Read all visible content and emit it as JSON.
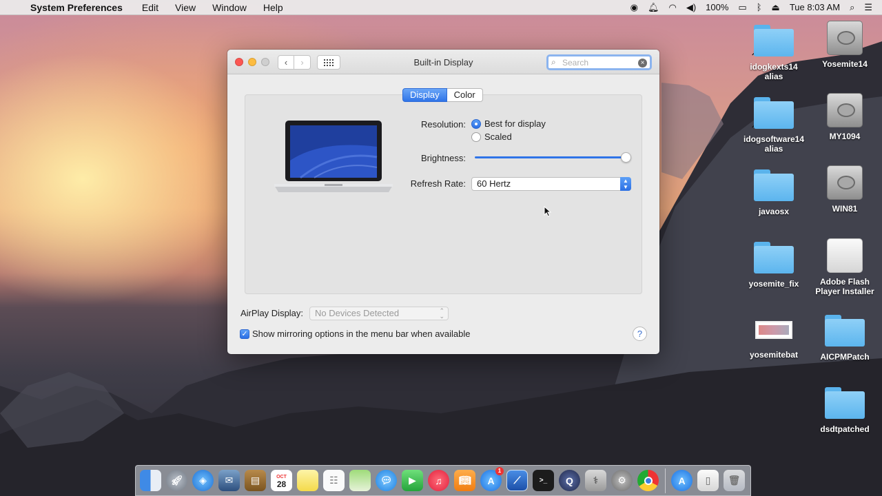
{
  "menubar": {
    "app_name": "System Preferences",
    "menus": [
      "Edit",
      "View",
      "Window",
      "Help"
    ],
    "battery": "100%",
    "clock": "Tue 8:03 AM"
  },
  "window": {
    "title": "Built-in Display",
    "search_placeholder": "Search",
    "tabs": [
      {
        "label": "Display",
        "active": true
      },
      {
        "label": "Color",
        "active": false
      }
    ],
    "resolution_label": "Resolution:",
    "resolution_options": [
      {
        "label": "Best for display",
        "selected": true
      },
      {
        "label": "Scaled",
        "selected": false
      }
    ],
    "brightness_label": "Brightness:",
    "brightness_value": 1.0,
    "refresh_label": "Refresh Rate:",
    "refresh_value": "60 Hertz",
    "airplay_label": "AirPlay Display:",
    "airplay_value": "No Devices Detected",
    "mirroring_label": "Show mirroring options in the menu bar when available",
    "mirroring_checked": true,
    "help": "?"
  },
  "desktop": {
    "icons": [
      {
        "name": "idogkexts14 alias",
        "line1": "idogkexts14",
        "line2": "alias",
        "kind": "folder"
      },
      {
        "name": "Yosemite14",
        "line1": "Yosemite14",
        "line2": "",
        "kind": "disk"
      },
      {
        "name": "idogsoftware14 alias",
        "line1": "idogsoftware14",
        "line2": "alias",
        "kind": "folder"
      },
      {
        "name": "MY1094",
        "line1": "MY1094",
        "line2": "",
        "kind": "disk"
      },
      {
        "name": "javaosx",
        "line1": "javaosx",
        "line2": "",
        "kind": "folder"
      },
      {
        "name": "WIN81",
        "line1": "WIN81",
        "line2": "",
        "kind": "disk"
      },
      {
        "name": "yosemite_fix",
        "line1": "yosemite_fix",
        "line2": "",
        "kind": "folder"
      },
      {
        "name": "Adobe Flash Player Installer",
        "line1": "Adobe Flash",
        "line2": "Player Installer",
        "kind": "disk-white"
      },
      {
        "name": "yosemitebat",
        "line1": "yosemitebat",
        "line2": "",
        "kind": "image"
      },
      {
        "name": "AICPMPatch",
        "line1": "AICPMPatch",
        "line2": "",
        "kind": "folder"
      },
      {
        "name": "dsdtpatched",
        "line1": "dsdtpatched",
        "line2": "",
        "kind": "folder"
      }
    ]
  },
  "dock": {
    "calendar_month": "OCT",
    "calendar_day": "28",
    "appstore_badge": "1"
  }
}
